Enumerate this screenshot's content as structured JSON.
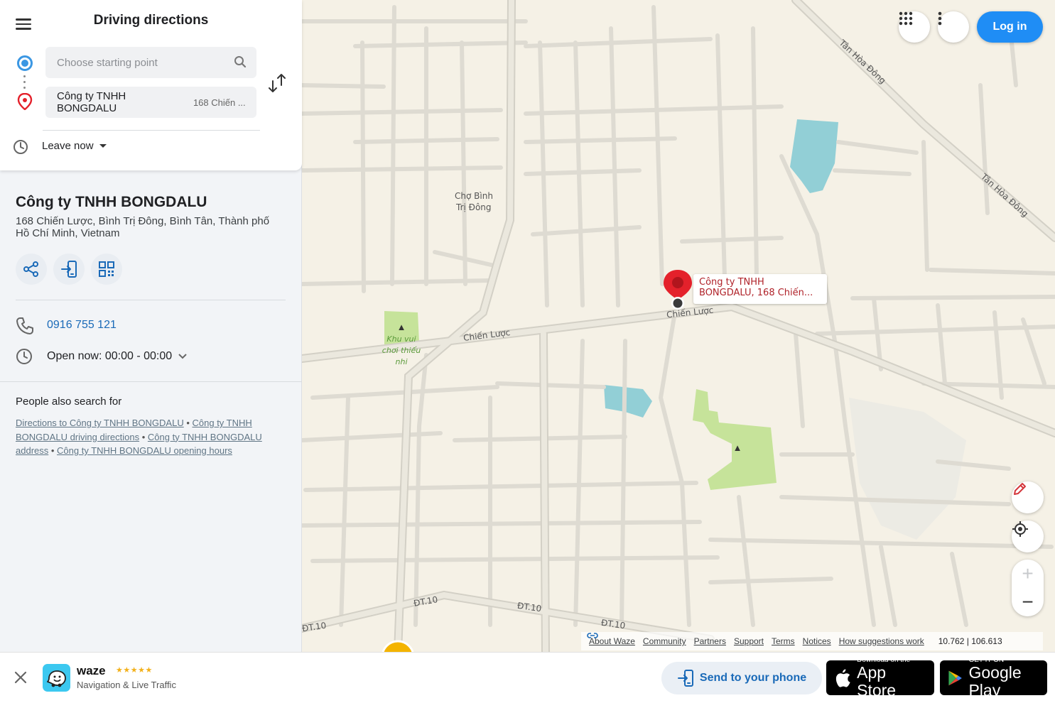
{
  "directions": {
    "title": "Driving directions",
    "start_placeholder": "Choose starting point",
    "destination_name": "Công ty TNHH BONGDALU",
    "destination_sub": "168 Chiến ...",
    "leave_label": "Leave now"
  },
  "place": {
    "name": "Công ty TNHH BONGDALU",
    "address": "168 Chiến Lược, Bình Trị Đông, Bình Tân, Thành phố Hồ Chí Minh, Vietnam",
    "phone": "0916 755 121",
    "hours": "Open now: 00:00 - 00:00"
  },
  "also_search": {
    "title": "People also search for",
    "links": [
      "Directions to Công ty TNHH BONGDALU",
      "Công ty TNHH BONGDALU driving directions",
      "Công ty TNHH BONGDALU address",
      "Công ty TNHH BONGDALU opening hours"
    ]
  },
  "header": {
    "login_label": "Log in"
  },
  "map": {
    "marker_label": "Công ty TNHH BONGDALU, 168 Chiến...",
    "labels": {
      "cho_binh_tri_dong_1": "Chợ Bình",
      "cho_binh_tri_dong_2": "Trị Đông",
      "chien_luoc_1": "Chiến Lược",
      "chien_luoc_2": "Chiến Lược",
      "tan_hoa_dong_1": "Tân Hòa Đông",
      "tan_hoa_dong_2": "Tân Hòa Đông",
      "dt10_1": "ĐT.10",
      "dt10_2": "ĐT.10",
      "dt10_3": "ĐT.10",
      "dt10_4": "ĐT.10",
      "park_1": "Khu vui",
      "park_2": "chơi thiếu",
      "park_3": "nhi"
    },
    "coords": "10.762 | 106.613"
  },
  "footer_links": [
    "About Waze",
    "Community",
    "Partners",
    "Support",
    "Terms",
    "Notices",
    "How suggestions work"
  ],
  "bottom_bar": {
    "brand": "waze",
    "stars": "★★★★★",
    "tagline": "Navigation & Live Traffic",
    "send_label": "Send to your phone",
    "appstore_small": "Download on the",
    "appstore_big": "App Store",
    "play_small": "GET IT ON",
    "play_big": "Google Play"
  },
  "colors": {
    "accent_blue": "#1f8df5",
    "link_blue": "#1a6ab8",
    "marker_red": "#e4212b",
    "park_green": "#c6e39a",
    "water_blue": "#92cfd6"
  }
}
